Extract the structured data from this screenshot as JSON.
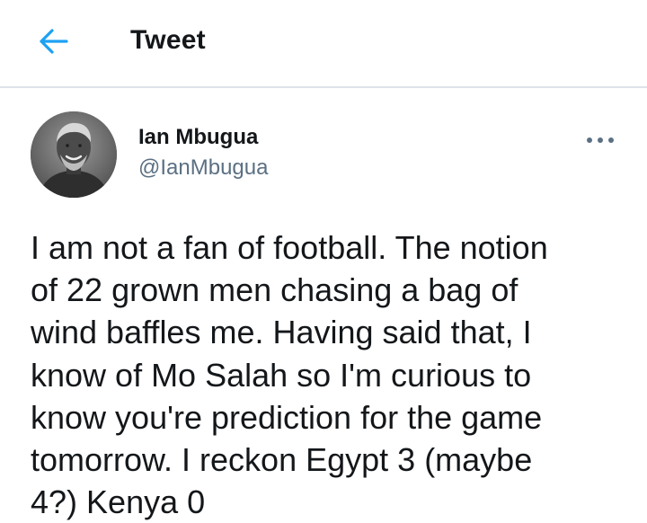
{
  "header": {
    "title": "Tweet",
    "back_icon": "arrow-left-icon",
    "accent_color": "#1da1f2"
  },
  "tweet": {
    "author": {
      "name": "Ian Mbugua",
      "handle": "@IanMbugua",
      "avatar_icon": "avatar-photo"
    },
    "more_icon": "more-horizontal-icon",
    "text": "I am not a fan of football. The notion\nof 22 grown men chasing a bag of\nwind baffles me. Having said that, I\nknow of Mo Salah so I'm curious to\nknow you're prediction for the game\ntomorrow. I reckon Egypt 3 (maybe\n4?) Kenya 0"
  }
}
